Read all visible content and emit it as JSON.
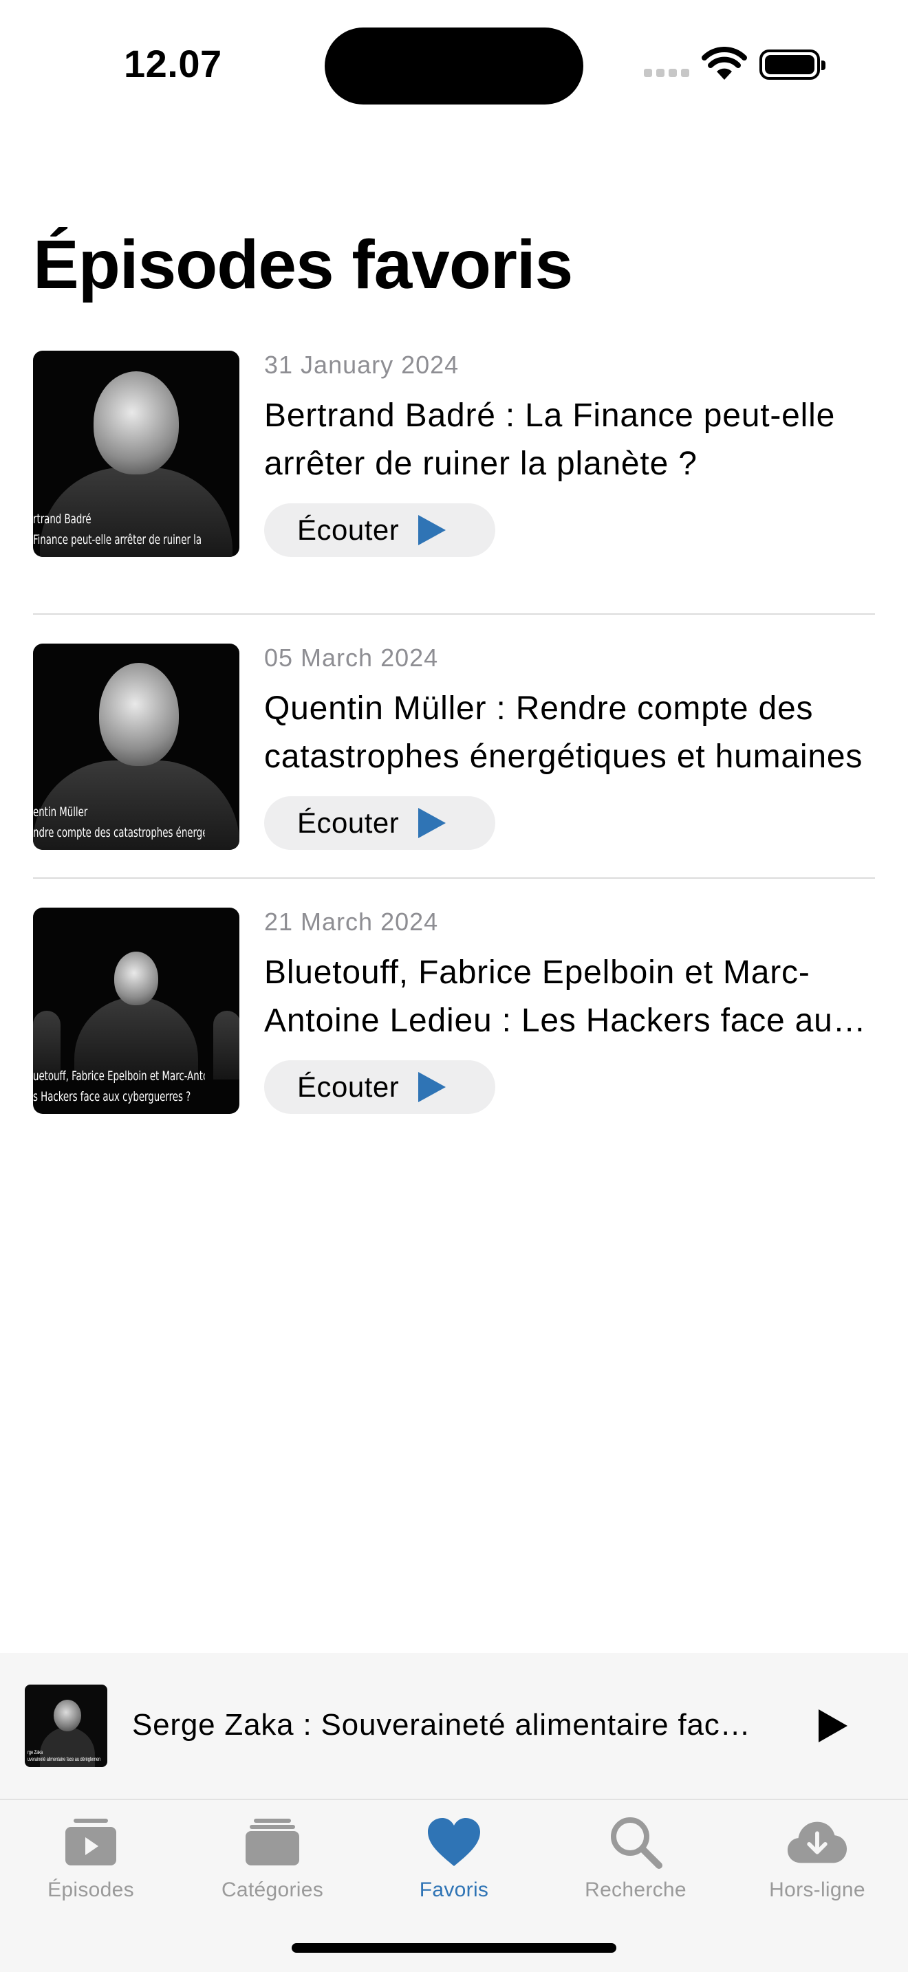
{
  "status_bar": {
    "time": "12.07"
  },
  "page": {
    "title": "Épisodes favoris"
  },
  "episodes": [
    {
      "date": "31 January 2024",
      "title": "Bertrand Badré : La Finance peut-elle arrêter de ruiner la planète ?",
      "thumb_caption_line1": "rtrand Badré",
      "thumb_caption_line2": "Finance peut-elle arrêter de ruiner la plan",
      "button_label": "Écouter"
    },
    {
      "date": "05 March 2024",
      "title": "Quentin Müller : Rendre compte des catastrophes énergétiques et humaines",
      "thumb_caption_line1": "entin Müller",
      "thumb_caption_line2": "ndre compte des catastrophes énergétiques e",
      "button_label": "Écouter"
    },
    {
      "date": "21 March 2024",
      "title": "Bluetouff, Fabrice Epelboin et Marc-Antoine Ledieu : Les Hackers face aux cyberguerres ?",
      "thumb_caption_line1": "uetouff, Fabrice Epelboin et Marc-Antoine Ledieu",
      "thumb_caption_line2": "s Hackers face aux cyberguerres ?",
      "button_label": "Écouter"
    }
  ],
  "mini_player": {
    "title": "Serge Zaka : Souveraineté alimentaire face aux dérèglements",
    "thumb_caption_line1": "rge Zaka",
    "thumb_caption_line2": "uveraineté alimentaire face au dérèglemen"
  },
  "tabs": [
    {
      "label": "Épisodes",
      "icon": "play-rectangle-icon",
      "active": false
    },
    {
      "label": "Catégories",
      "icon": "stack-icon",
      "active": false
    },
    {
      "label": "Favoris",
      "icon": "heart-icon",
      "active": true
    },
    {
      "label": "Recherche",
      "icon": "magnifier-icon",
      "active": false
    },
    {
      "label": "Hors-ligne",
      "icon": "cloud-download-icon",
      "active": false
    }
  ],
  "colors": {
    "accent": "#2f74b5",
    "inactive": "#9a9a9a",
    "date": "#8e8e93",
    "button_bg": "#eeeeef"
  }
}
